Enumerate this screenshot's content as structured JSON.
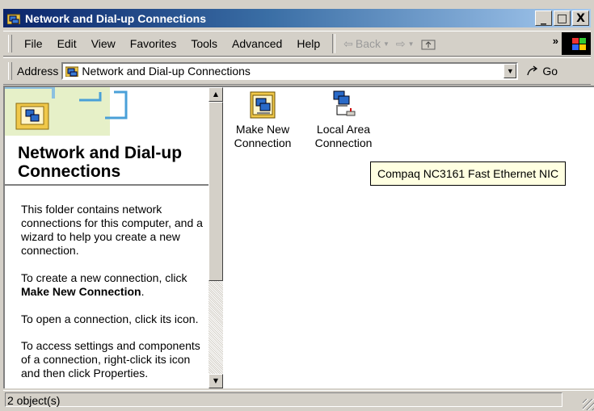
{
  "window": {
    "title": "Network and Dial-up Connections",
    "buttons": {
      "minimize": "_",
      "maximize": "□",
      "close": "X"
    }
  },
  "menubar": {
    "items": [
      "File",
      "Edit",
      "View",
      "Favorites",
      "Tools",
      "Advanced",
      "Help"
    ],
    "back_label": "Back",
    "more_chevron": "»"
  },
  "addressbar": {
    "label": "Address",
    "value": "Network and Dial-up Connections",
    "go_label": "Go"
  },
  "leftpane": {
    "title": "Network and Dial-up Connections",
    "para1": "This folder contains network connections for this computer, and a wizard to help you create a new connection.",
    "para2_prefix": "To create a new connection, click",
    "para2_bold": "Make New Connection",
    "para2_suffix": ".",
    "para3": "To open a connection, click its icon.",
    "para4": "To access settings and components of a connection, right-click its icon and then click Properties."
  },
  "icons": [
    {
      "label_line1": "Make New",
      "label_line2": "Connection",
      "icon": "make-new-connection-icon"
    },
    {
      "label_line1": "Local Area",
      "label_line2": "Connection",
      "icon": "local-area-connection-icon"
    }
  ],
  "tooltip": "Compaq NC3161 Fast Ethernet NIC",
  "statusbar": {
    "text": "2 object(s)"
  }
}
